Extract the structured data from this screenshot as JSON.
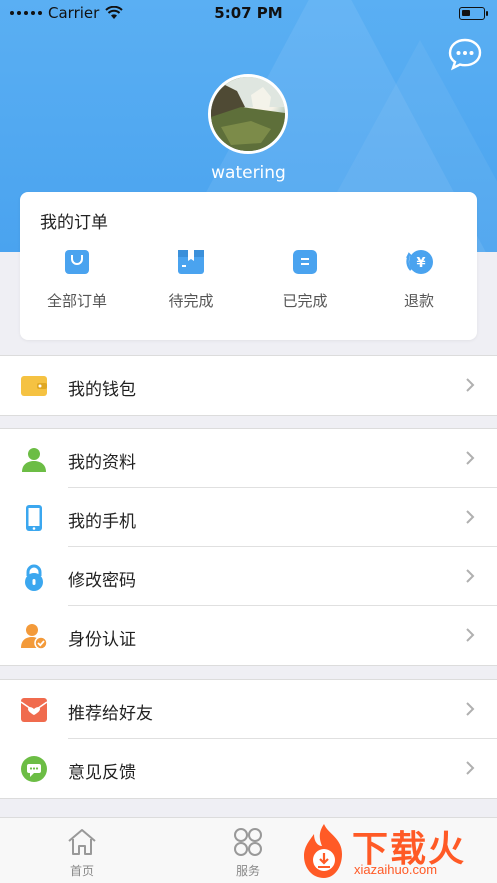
{
  "status_bar": {
    "carrier": "Carrier",
    "time": "5:07 PM"
  },
  "profile": {
    "username": "watering"
  },
  "orders": {
    "title": "我的订单",
    "items": [
      {
        "label": "全部订单",
        "icon": "shopping-bag-icon"
      },
      {
        "label": "待完成",
        "icon": "pending-box-icon"
      },
      {
        "label": "已完成",
        "icon": "completed-icon"
      },
      {
        "label": "退款",
        "icon": "refund-yen-icon"
      }
    ]
  },
  "menu": {
    "wallet": {
      "label": "我的钱包"
    },
    "profile": {
      "label": "我的资料"
    },
    "phone": {
      "label": "我的手机"
    },
    "password": {
      "label": "修改密码"
    },
    "identity": {
      "label": "身份认证"
    },
    "recommend": {
      "label": "推荐给好友"
    },
    "feedback": {
      "label": "意见反馈"
    }
  },
  "tabbar": {
    "tabs": [
      {
        "label": "首页",
        "icon": "home-icon"
      },
      {
        "label": "服务",
        "icon": "services-icon"
      }
    ]
  },
  "watermark": {
    "text": "下载火",
    "domain": "xiazaihuo.com"
  },
  "colors": {
    "header": "#4aa3ef",
    "accent": "#4aa3ef",
    "wallet": "#f5c242",
    "green": "#6cbd45",
    "orange": "#f39a3a",
    "red": "#f06b4e"
  }
}
